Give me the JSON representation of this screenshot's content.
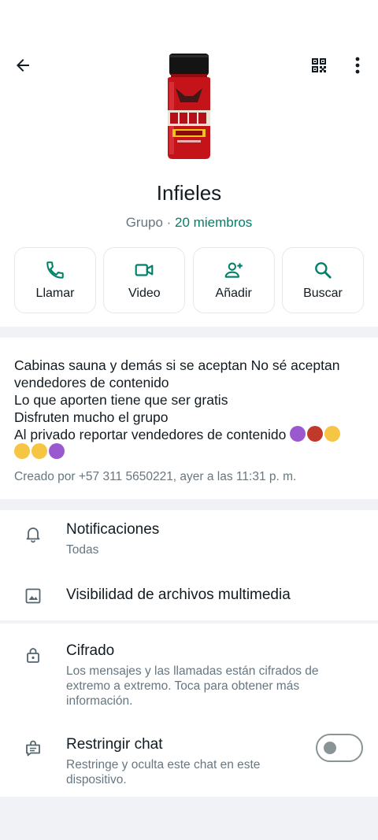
{
  "colors": {
    "accent": "#008069",
    "text_primary": "#111b21",
    "text_secondary": "#667781",
    "background": "#f0f2f5"
  },
  "toolbar": {
    "back_icon": "arrow-back-icon",
    "qr_icon": "qr-code-icon",
    "more_icon": "more-vert-icon"
  },
  "group": {
    "avatar": "bottle-product-image",
    "name": "Infieles",
    "type": "Grupo",
    "separator": " · ",
    "members": "20 miembros"
  },
  "actions": [
    {
      "label": "Llamar",
      "icon": "phone-icon"
    },
    {
      "label": "Video",
      "icon": "videocam-icon"
    },
    {
      "label": "Añadir",
      "icon": "person-add-icon"
    },
    {
      "label": "Buscar",
      "icon": "search-icon"
    }
  ],
  "description": {
    "line1": "Cabinas sauna y demás si se aceptan No sé aceptan vendedores de contenido",
    "line2": "Lo que aporten tiene que ser gratis",
    "line3": "Disfruten mucho el grupo",
    "line4": "Al privado reportar vendedores de contenido",
    "emojis_line4": [
      "smiling-devil-emoji",
      "angry-face-emoji",
      "smirk-emoji"
    ],
    "emojis_line5": [
      "tongue-wink-emoji",
      "relieved-emoji",
      "smiling-devil-emoji"
    ],
    "created": "Creado por +57 311 5650221, ayer a las 11:31 p. m."
  },
  "settings": {
    "notifications_title": "Notificaciones",
    "notifications_value": "Todas",
    "media_visibility": "Visibilidad de archivos multimedia"
  },
  "security": {
    "encryption_title": "Cifrado",
    "encryption_desc": "Los mensajes y las llamadas están cifrados de extremo a extremo. Toca para obtener más información.",
    "restrict_title": "Restringir chat",
    "restrict_desc": "Restringe y oculta este chat en este dispositivo.",
    "restrict_enabled": false
  }
}
